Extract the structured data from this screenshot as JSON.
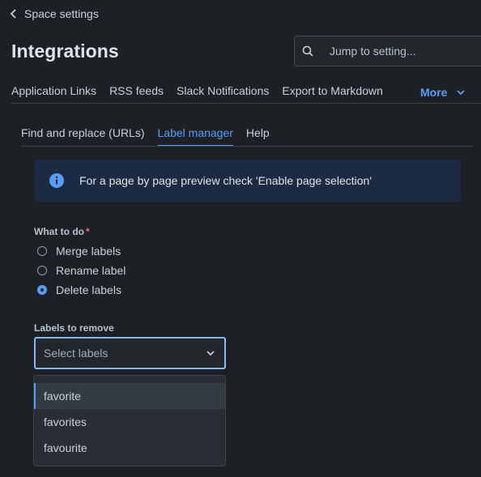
{
  "header": {
    "back_label": "Space settings",
    "title": "Integrations",
    "search_placeholder": "Jump to setting..."
  },
  "top_tabs": {
    "items": [
      "Application Links",
      "RSS feeds",
      "Slack Notifications",
      "Export to Markdown"
    ],
    "more_label": "More"
  },
  "sub_tabs": {
    "items": [
      "Find and replace (URLs)",
      "Label manager",
      "Help"
    ],
    "active": "Label manager"
  },
  "info_banner": {
    "text": "For a page by page preview check 'Enable page selection'"
  },
  "form": {
    "what_to_do_label": "What to do",
    "required_mark": "*",
    "options": [
      "Merge labels",
      "Rename label",
      "Delete labels"
    ],
    "selected_option": "Delete labels",
    "labels_to_remove_label": "Labels to remove",
    "labels_placeholder": "Select labels"
  },
  "dropdown": {
    "options": [
      "favorite",
      "favorites",
      "favourite"
    ],
    "highlighted": "favorite"
  },
  "colors": {
    "background": "#1d2125",
    "accent": "#579dff",
    "info_bg": "#1c2b41",
    "required": "#f87168"
  }
}
